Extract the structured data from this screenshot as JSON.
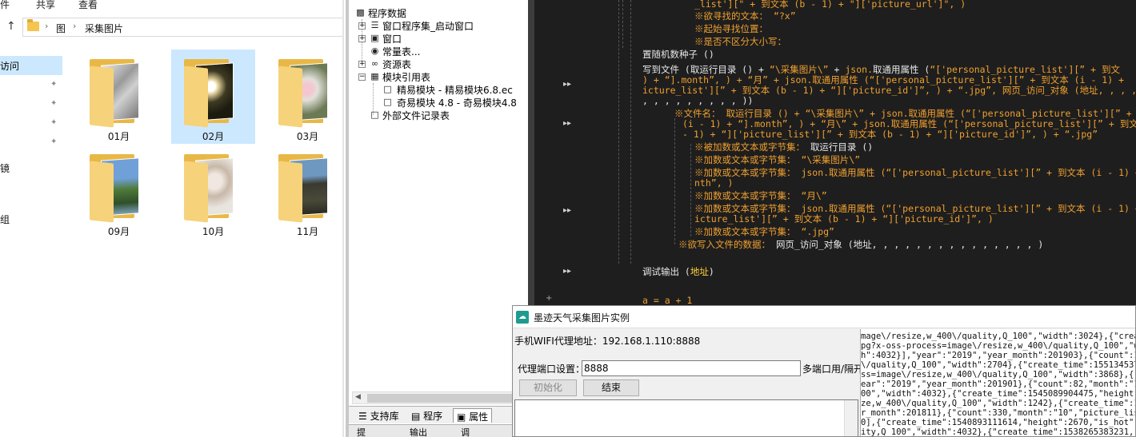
{
  "explorer": {
    "ribbon_tabs": [
      "件",
      "共享",
      "查看"
    ],
    "breadcrumb": [
      "图",
      "采集图片"
    ],
    "nav_selected": "访问",
    "nav_fragments": [
      "镜",
      "组"
    ],
    "folders": [
      {
        "name": "01月",
        "selected": false
      },
      {
        "name": "02月",
        "selected": true
      },
      {
        "name": "03月",
        "selected": false
      },
      {
        "name": "09月",
        "selected": false
      },
      {
        "name": "10月",
        "selected": false
      },
      {
        "name": "11月",
        "selected": false
      }
    ]
  },
  "tree": {
    "items": [
      {
        "label": "程序数据"
      },
      {
        "label": "窗口程序集_启动窗口"
      },
      {
        "label": "窗口"
      },
      {
        "label": "常量表..."
      },
      {
        "label": "资源表"
      },
      {
        "label": "模块引用表"
      },
      {
        "label": "精易模块 - 精易模块6.8.ec"
      },
      {
        "label": "奇易模块 4.8 - 奇易模块4.8"
      },
      {
        "label": "外部文件记录表"
      }
    ],
    "tabs": [
      "支持库",
      "程序",
      "属性"
    ],
    "bottom_tabs": [
      "提",
      "输出",
      "调"
    ]
  },
  "code": {
    "l1a": "_list'][\" + 到文本 (b - 1) + \"]['picture_url']\", )",
    "l2a": "※欲寻找的文本：",
    "l2b": "“?x”",
    "l3a": "※起始寻找位置：",
    "l4a": "※是否不区分大小写：",
    "l5": "置随机数种子 ()",
    "l6a": "写到文件 (取运行目录 () + ",
    "l6b": "“\\采集图片\\”",
    "l6c": " + ",
    "l6d": "json.",
    "l6e": "取通用属性 (",
    "l6f": "“['personal_picture_list'][” + 到文",
    "l7": ") + “].month”, ) + “月” + json.取通用属性 (“['personal_picture_list'][” + 到文本 (i - 1) +",
    "l8": "icture_list'][” + 到文本 (b - 1) + “]['picture_id']”, ) + “.jpg”, 网页_访问_对象 (地址, , , ,",
    "l9": ", , , , , , , , , ))",
    "l10a": "※文件名：",
    "l10b": "取运行目录 () + “\\采集图片\\” + json.取通用属性 (“['personal_picture_list'][” +",
    "l11": "(i - 1) + “].month”, ) + “月\\” + json.取通用属性 (“['personal_picture_list'][” + 到文",
    "l12": "- 1) + “]['picture_list'][” + 到文本 (b - 1) + “]['picture_id']”, ) + “.jpg”",
    "l13a": "※被加数或文本或字节集：",
    "l13b": "取运行目录 ()",
    "l14a": "※加数或文本或字节集：",
    "l14b": "“\\采集图片\\”",
    "l15a": "※加数或文本或字节集：",
    "l15b": "json.取通用属性 (“['personal_picture_list'][” + 到文本 (i - 1) +",
    "l16": "nth”, )",
    "l17a": "※加数或文本或字节集：",
    "l17b": "“月\\”",
    "l18a": "※加数或文本或字节集：",
    "l18b": "json.取通用属性 (“['personal_picture_list'][” + 到文本 (i - 1) +",
    "l19": "icture_list'][” + 到文本 (b - 1) + “]['picture_id']”, )",
    "l20a": "※加数或文本或字节集：",
    "l20b": "“.jpg”",
    "l21a": "※欲写入文件的数据：",
    "l21b": "网页_访问_对象 (地址, , , , , , , , , , , , , , , )",
    "l22a": "调试输出 (",
    "l22b": "地址",
    "l22c": ")",
    "l23": "a = a + 1",
    "gutter_mark": "▸▸"
  },
  "app": {
    "title": "墨迹天气采集图片实例",
    "proxy_address_label": "手机WIFI代理地址：",
    "proxy_address": "192.168.1.110:8888",
    "port_label": "代理端口设置：",
    "port_value": "8888",
    "multiport_label": "多端口用/隔开",
    "btn_init": "初始化",
    "btn_end": "结束",
    "json_lines": [
      "mage\\/resize,w_400\\/quality,Q_100\",\"width\":3024},{\"create_",
      "pg?x-oss-process=image\\/resize,w_400\\/quality,Q_100\",\"wid",
      "h\":4032}],\"year\":\"2019\",\"year_month\":201903},{\"count\":110,",
      "\\/quality,Q_100\",\"width\":2704},{\"create_time\":15513453748",
      "ss=image\\/resize,w_400\\/quality,Q_100\",\"width\":3868},{\"cre",
      "ear\":\"2019\",\"year_month\":201901},{\"count\":82,\"month\":\"12\",",
      "00\",\"width\":4032},{\"create_time\":1545089904475,\"height\":22",
      "ze,w_400\\/quality,Q_100\",\"width\":1242},{\"create_time\":154",
      "r_month\":201811},{\"count\":330,\"month\":\"10\",\"picture_list\":",
      "0],{\"create_time\":1540893111614,\"height\":2670,\"is_hot\":fal",
      "ity,Q_100\",\"width\":4032},{\"create_time\":1538265383231,\"hei"
    ]
  }
}
